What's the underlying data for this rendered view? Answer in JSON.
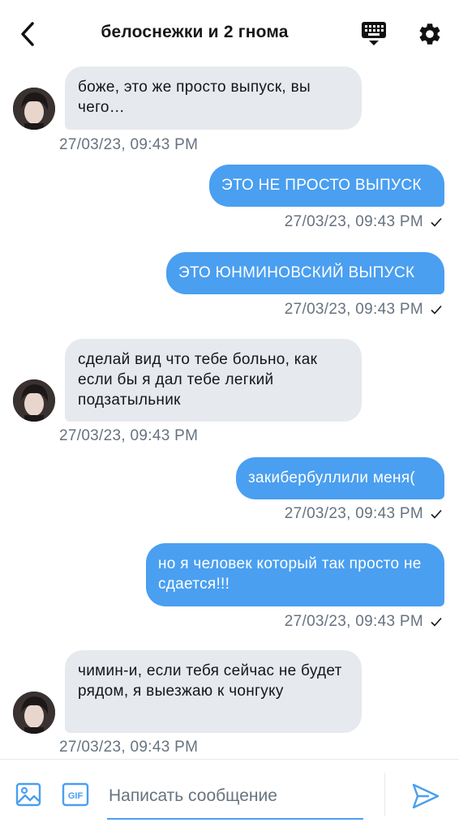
{
  "header": {
    "title": "белоснежки и 2 гнома",
    "back_icon": "chevron-left-icon",
    "keyboard_icon": "keyboard-icon",
    "settings_icon": "gear-icon"
  },
  "messages": [
    {
      "direction": "in",
      "text": "боже, это же просто выпуск, вы чего…",
      "timestamp": "27/03/23, 09:43 PM"
    },
    {
      "direction": "out",
      "text": "ЭТО НЕ ПРОСТО ВЫПУСК",
      "timestamp": "27/03/23, 09:43 PM"
    },
    {
      "direction": "out",
      "text": "ЭТО ЮНМИНОВСКИЙ ВЫПУСК",
      "timestamp": "27/03/23, 09:43 PM"
    },
    {
      "direction": "in",
      "text": "сделай вид что тебе больно, как если бы я дал тебе легкий подзатыльник",
      "timestamp": "27/03/23, 09:43 PM"
    },
    {
      "direction": "out",
      "text": "закибербуллили меня(",
      "timestamp": "27/03/23, 09:43 PM"
    },
    {
      "direction": "out",
      "text": "но я человек который так просто не сдается!!!",
      "timestamp": "27/03/23, 09:43 PM"
    },
    {
      "direction": "in",
      "text": "чимин-и, если тебя сейчас не будет рядом, я выезжаю к чонгуку",
      "timestamp": "27/03/23, 09:43 PM"
    }
  ],
  "composer": {
    "placeholder": "Написать сообщение",
    "value": "",
    "image_icon": "image-icon",
    "gif_icon": "gif-icon",
    "send_icon": "send-icon",
    "gif_label": "GIF"
  },
  "colors": {
    "accent": "#4a9ff0",
    "incoming_bubble": "#e6e9ee",
    "timestamp": "#677380"
  }
}
